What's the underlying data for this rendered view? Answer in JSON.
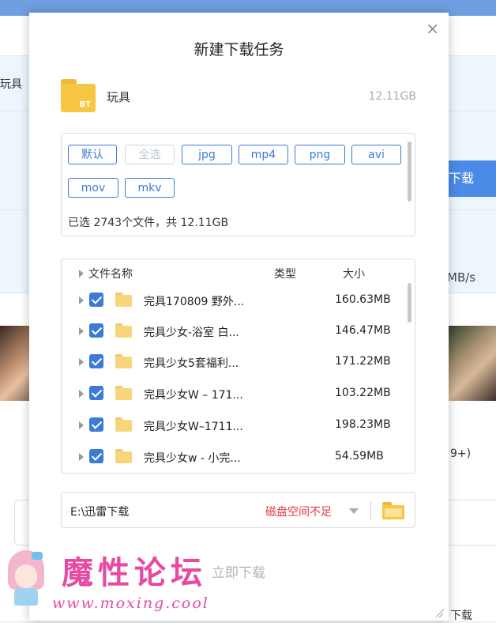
{
  "background": {
    "left_text": "玩具",
    "blue_button_label": "下载",
    "speed_text": "MB/s",
    "count_text": "9+)",
    "bottom_text": "下载"
  },
  "dialog": {
    "title": "新建下载任务",
    "close_glyph": "×",
    "torrent": {
      "badge": "BT",
      "name": "玩具",
      "size": "12.11GB"
    },
    "filters": {
      "chips": [
        {
          "label": "默认",
          "enabled": true
        },
        {
          "label": "全选",
          "enabled": false
        },
        {
          "label": "jpg",
          "enabled": true
        },
        {
          "label": "mp4",
          "enabled": true
        },
        {
          "label": "png",
          "enabled": true
        },
        {
          "label": "avi",
          "enabled": true
        },
        {
          "label": "mov",
          "enabled": true
        },
        {
          "label": "mkv",
          "enabled": true
        }
      ],
      "summary": "已选 2743个文件，共 12.11GB"
    },
    "file_list": {
      "columns": {
        "name": "文件名称",
        "type": "类型",
        "size": "大小"
      },
      "rows": [
        {
          "name": "完具170809 野外...",
          "size": "160.63MB",
          "checked": true
        },
        {
          "name": "完具少女-浴室 白...",
          "size": "146.47MB",
          "checked": true
        },
        {
          "name": "完具少女5套福利...",
          "size": "171.22MB",
          "checked": true
        },
        {
          "name": "完具少女W – 171...",
          "size": "103.22MB",
          "checked": true
        },
        {
          "name": "完具少女W–1711...",
          "size": "198.23MB",
          "checked": true
        },
        {
          "name": "完具少女w - 小完...",
          "size": "54.59MB",
          "checked": true
        }
      ]
    },
    "save_path": {
      "path": "E:\\迅雷下载",
      "warning": "磁盘空间不足"
    },
    "download_button": "立即下载"
  },
  "watermark": {
    "title": "魔性论坛",
    "url": "www.moxing.cool"
  },
  "colors": {
    "accent": "#3b7ad6",
    "warning": "#e0393e",
    "folder": "#f7c744",
    "watermark": "#e84aa2"
  }
}
